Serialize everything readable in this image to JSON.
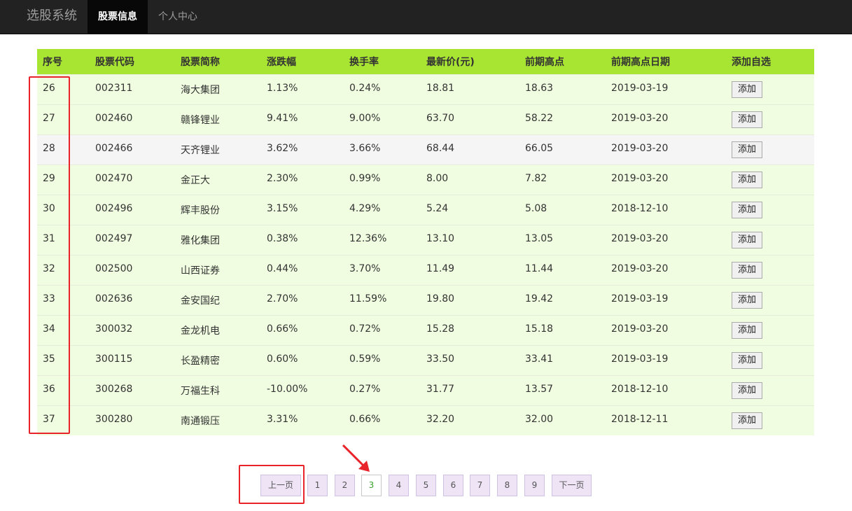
{
  "navbar": {
    "brand": "选股系统",
    "items": [
      {
        "label": "股票信息",
        "active": true
      },
      {
        "label": "个人中心",
        "active": false
      }
    ]
  },
  "table": {
    "headers": [
      "序号",
      "股票代码",
      "股票简称",
      "涨跌幅",
      "换手率",
      "最新价(元)",
      "前期高点",
      "前期高点日期",
      "添加自选"
    ],
    "rows": [
      [
        "26",
        "002311",
        "海大集团",
        "1.13%",
        "0.24%",
        "18.81",
        "18.63",
        "2019-03-19"
      ],
      [
        "27",
        "002460",
        "赣锋锂业",
        "9.41%",
        "9.00%",
        "63.70",
        "58.22",
        "2019-03-20"
      ],
      [
        "28",
        "002466",
        "天齐锂业",
        "3.62%",
        "3.66%",
        "68.44",
        "66.05",
        "2019-03-20"
      ],
      [
        "29",
        "002470",
        "金正大",
        "2.30%",
        "0.99%",
        "8.00",
        "7.82",
        "2019-03-20"
      ],
      [
        "30",
        "002496",
        "辉丰股份",
        "3.15%",
        "4.29%",
        "5.24",
        "5.08",
        "2018-12-10"
      ],
      [
        "31",
        "002497",
        "雅化集团",
        "0.38%",
        "12.36%",
        "13.10",
        "13.05",
        "2019-03-20"
      ],
      [
        "32",
        "002500",
        "山西证券",
        "0.44%",
        "3.70%",
        "11.49",
        "11.44",
        "2019-03-20"
      ],
      [
        "33",
        "002636",
        "金安国纪",
        "2.70%",
        "11.59%",
        "19.80",
        "19.42",
        "2019-03-19"
      ],
      [
        "34",
        "300032",
        "金龙机电",
        "0.66%",
        "0.72%",
        "15.28",
        "15.18",
        "2019-03-20"
      ],
      [
        "35",
        "300115",
        "长盈精密",
        "0.60%",
        "0.59%",
        "33.50",
        "33.41",
        "2019-03-19"
      ],
      [
        "36",
        "300268",
        "万福生科",
        "-10.00%",
        "0.27%",
        "31.77",
        "13.57",
        "2018-12-10"
      ],
      [
        "37",
        "300280",
        "南通锻压",
        "3.31%",
        "0.66%",
        "32.20",
        "32.00",
        "2018-12-11"
      ]
    ],
    "add_label": "添加"
  },
  "pagination": {
    "prev": "上一页",
    "pages": [
      "1",
      "2",
      "3",
      "4",
      "5",
      "6",
      "7",
      "8",
      "9"
    ],
    "current": "3",
    "next": "下一页"
  },
  "colors": {
    "header_bg": "#a8e432",
    "row_bg": "#f0fde0",
    "annotation": "#e8232a"
  }
}
